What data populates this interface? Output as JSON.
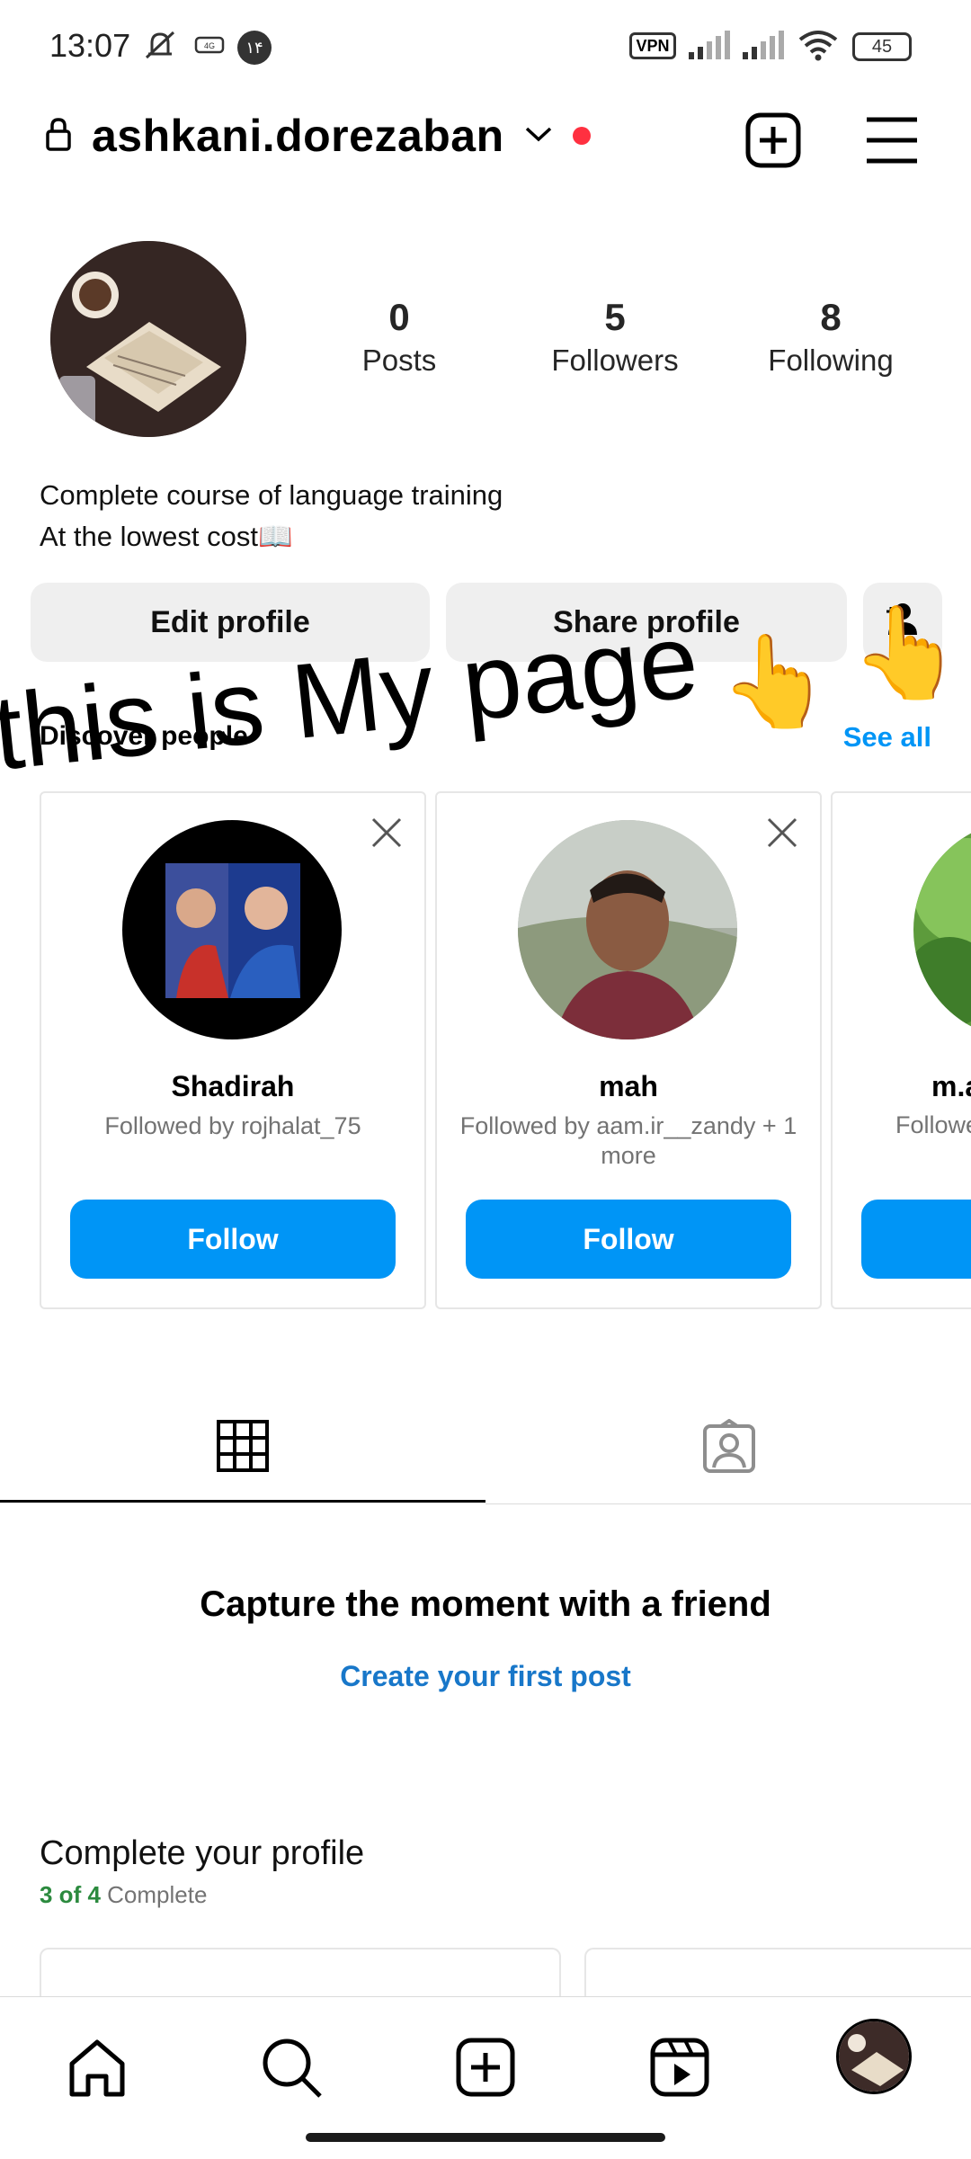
{
  "status_bar": {
    "time": "13:07",
    "indicators": [
      "mute-icon",
      "sim-icon",
      "notification-badge"
    ],
    "badge_digit": "۱۴",
    "vpn": "VPN",
    "battery": "45"
  },
  "header": {
    "username": "ashkani.dorezaban",
    "icons": [
      "lock-icon",
      "chevron-down-icon",
      "new-post-icon",
      "menu-icon"
    ]
  },
  "profile": {
    "stats": [
      {
        "value": "0",
        "label": "Posts"
      },
      {
        "value": "5",
        "label": "Followers"
      },
      {
        "value": "8",
        "label": "Following"
      }
    ],
    "bio_line1": "Complete course of language training",
    "bio_line2": "At the lowest cost📖",
    "edit_label": "Edit profile",
    "share_label": "Share profile"
  },
  "overlay": {
    "text": "this is My page",
    "emoji": "👆"
  },
  "discover": {
    "label": "Discover people",
    "see_all": "See all",
    "follow_label": "Follow",
    "cards": [
      {
        "name": "Shadirah",
        "sub": "Followed by rojhalat_75"
      },
      {
        "name": "mah",
        "sub": "Followed by aam.ir__zandy + 1 more"
      },
      {
        "name": "m.a",
        "sub": "Followe"
      }
    ]
  },
  "empty_state": {
    "title": "Capture the moment with a friend",
    "link": "Create your first post"
  },
  "complete_profile": {
    "title": "Complete your profile",
    "progress_text": "3 of 4",
    "progress_suffix": " Complete"
  },
  "colors": {
    "accent": "#0095f6",
    "button_gray": "#efefef",
    "notification": "#ff3040"
  }
}
